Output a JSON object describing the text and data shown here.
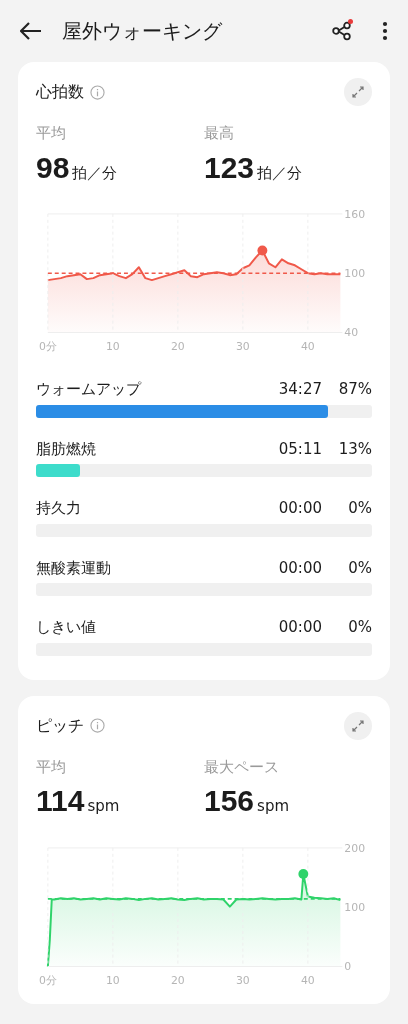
{
  "header": {
    "title": "屋外ウォーキング",
    "share_badge": true
  },
  "heart_rate": {
    "title": "心拍数",
    "stats": [
      {
        "label": "平均",
        "value": "98",
        "unit": "拍／分"
      },
      {
        "label": "最高",
        "value": "123",
        "unit": "拍／分"
      }
    ],
    "chart_data": {
      "type": "area",
      "xlim": [
        0,
        45
      ],
      "ylim": [
        40,
        160
      ],
      "xticks": [
        {
          "value": 0,
          "label": "0分"
        },
        10,
        20,
        30,
        40
      ],
      "yticks": [
        40,
        100,
        160
      ],
      "x": [
        0,
        1,
        2,
        3,
        4,
        5,
        6,
        7,
        8,
        9,
        10,
        11,
        12,
        13,
        14,
        15,
        16,
        17,
        18,
        19,
        20,
        21,
        22,
        23,
        24,
        25,
        26,
        27,
        28,
        29,
        30,
        31,
        32,
        33,
        34,
        35,
        36,
        37,
        38,
        39,
        40,
        41,
        42,
        43,
        44,
        45
      ],
      "series": [
        {
          "color": "#f0594a",
          "values": [
            93,
            94,
            95,
            97,
            98,
            99,
            94,
            95,
            98,
            99,
            100,
            97,
            95,
            99,
            106,
            95,
            93,
            95,
            97,
            99,
            101,
            103,
            97,
            96,
            99,
            100,
            101,
            100,
            98,
            99,
            105,
            108,
            116,
            123,
            110,
            106,
            114,
            110,
            108,
            104,
            100,
            99,
            100,
            99,
            99,
            99
          ]
        }
      ],
      "ref_lines": [
        {
          "axis": "y",
          "value": 100,
          "color": "#f0594a"
        }
      ],
      "grid": true
    },
    "zones": [
      {
        "name": "ウォームアップ",
        "time": "34:27",
        "percent": "87%",
        "level": 0.87,
        "color": "#2b8de6"
      },
      {
        "name": "脂肪燃焼",
        "time": "05:11",
        "percent": "13%",
        "level": 0.13,
        "color": "#3ddccb"
      },
      {
        "name": "持久力",
        "time": "00:00",
        "percent": "0%"
      },
      {
        "name": "無酸素運動",
        "time": "00:00",
        "percent": "0%"
      },
      {
        "name": "しきい値",
        "time": "00:00",
        "percent": "0%"
      }
    ]
  },
  "cadence": {
    "title": "ピッチ",
    "stats": [
      {
        "label": "平均",
        "value": "114",
        "unit": "spm"
      },
      {
        "label": "最大ペース",
        "value": "156",
        "unit": "spm"
      }
    ],
    "chart_data": {
      "type": "area",
      "xlim": [
        0,
        45
      ],
      "ylim": [
        0,
        200
      ],
      "xticks": [
        {
          "value": 0,
          "label": "0分"
        },
        10,
        20,
        30,
        40
      ],
      "yticks": [
        0,
        100,
        200
      ],
      "x": [
        0,
        0.3,
        0.6,
        1,
        2,
        3,
        4,
        5,
        6,
        7,
        8,
        9,
        10,
        11,
        12,
        13,
        14,
        15,
        16,
        17,
        18,
        19,
        20,
        21,
        22,
        23,
        24,
        25,
        26,
        27,
        28,
        29,
        30,
        31,
        32,
        33,
        34,
        35,
        36,
        37,
        38,
        39,
        39.3,
        40,
        41,
        42,
        43,
        44,
        45
      ],
      "series": [
        {
          "color": "#2fd36a",
          "values": [
            0,
            45,
            113,
            113,
            115,
            114,
            115,
            113,
            114,
            115,
            113,
            115,
            114,
            113,
            115,
            114,
            112,
            114,
            115,
            113,
            114,
            115,
            113,
            112,
            114,
            115,
            113,
            114,
            114,
            113,
            101,
            113,
            114,
            113,
            114,
            115,
            114,
            113,
            114,
            114,
            115,
            113,
            156,
            118,
            116,
            115,
            114,
            115,
            112
          ]
        }
      ],
      "ref_lines": [
        {
          "axis": "y",
          "value": 114,
          "color": "#2fd36a"
        }
      ],
      "grid": true
    }
  }
}
